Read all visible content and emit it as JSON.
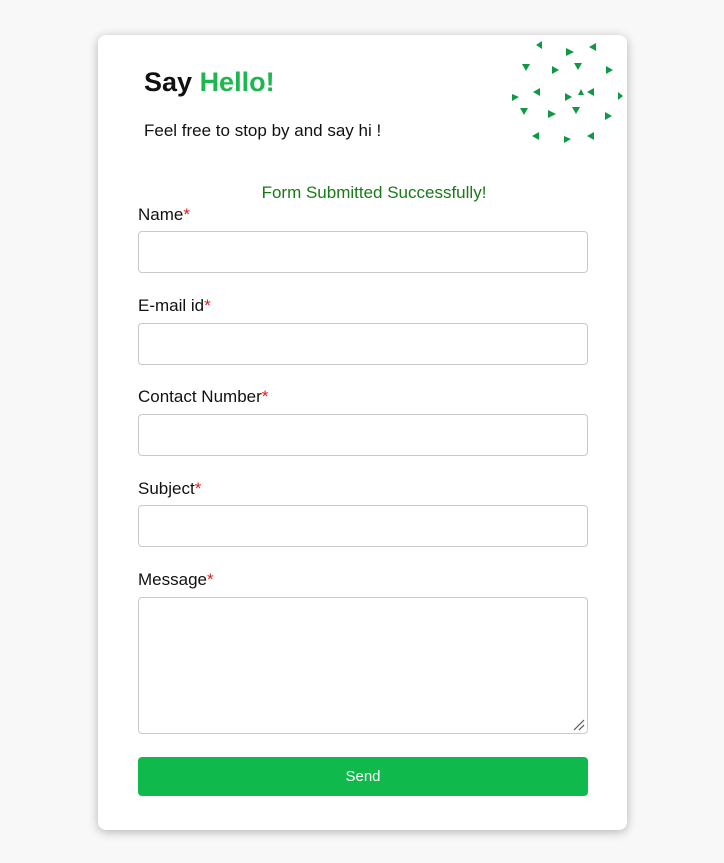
{
  "heading": {
    "prefix": "Say",
    "accent": "Hello!"
  },
  "tagline": "Feel free to stop by and say hi !",
  "status_message": "Form Submitted Successfully!",
  "required_marker": "*",
  "fields": {
    "name": {
      "label": "Name",
      "value": "",
      "placeholder": ""
    },
    "email": {
      "label": "E-mail id",
      "value": "",
      "placeholder": ""
    },
    "contact": {
      "label": "Contact Number",
      "value": "",
      "placeholder": ""
    },
    "subject": {
      "label": "Subject",
      "value": "",
      "placeholder": ""
    },
    "message": {
      "label": "Message",
      "value": "",
      "placeholder": ""
    }
  },
  "send_button": {
    "label": "Send"
  },
  "colors": {
    "accent": "#1db74f",
    "button": "#10b94b",
    "success": "#187a18",
    "required": "#e0181e",
    "decor": "#0e9a45"
  },
  "decor_icon": "scattered-triangles-decoration"
}
